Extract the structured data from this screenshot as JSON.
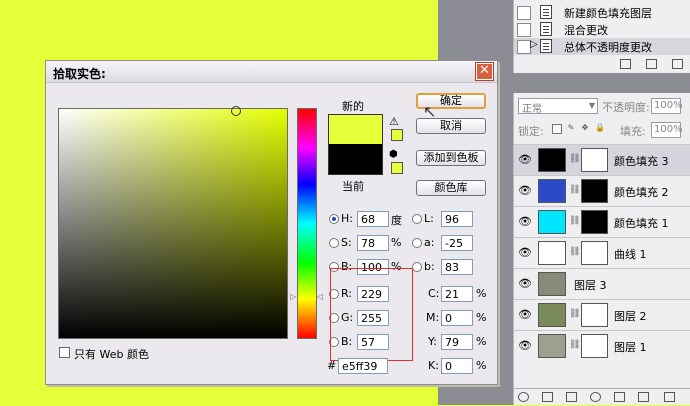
{
  "colors": {
    "foreground_new": "#e5ff39",
    "foreground_current": "#000000",
    "accent_close": "#d9603f"
  },
  "history": {
    "items": [
      {
        "label": "新建颜色填充图层",
        "selected": false
      },
      {
        "label": "混合更改",
        "selected": false
      },
      {
        "label": "总体不透明度更改",
        "selected": true
      }
    ]
  },
  "layers": {
    "blend_mode": "正常",
    "opacity_label": "不透明度:",
    "opacity_value": "100%",
    "lock_label": "锁定:",
    "fill_label": "填充:",
    "fill_value": "100%",
    "items": [
      {
        "name": "颜色填充 3",
        "thumb_color": "#000000",
        "mask": "#ffffff",
        "selected": true
      },
      {
        "name": "颜色填充 2",
        "thumb_color": "#2b49c8",
        "mask": "#000000",
        "selected": false
      },
      {
        "name": "颜色填充 1",
        "thumb_color": "#00e5ff",
        "mask": "#000000",
        "selected": false
      },
      {
        "name": "曲线 1",
        "thumb_color": "#ffffff",
        "mask": "#ffffff",
        "selected": false
      },
      {
        "name": "图层 3",
        "thumb_color": "#8a8a7a",
        "mask": "",
        "selected": false
      },
      {
        "name": "图层 2",
        "thumb_color": "#7a8a5a",
        "mask": "#ffffff",
        "selected": false
      },
      {
        "name": "图层 1",
        "thumb_color": "#a0a090",
        "mask": "#ffffff",
        "selected": false
      }
    ]
  },
  "dialog": {
    "title": "拾取实色:",
    "close_label": "✕",
    "new_label": "新的",
    "current_label": "当前",
    "buttons": {
      "ok": "确定",
      "cancel": "取消",
      "add_swatch": "添加到色板",
      "libraries": "颜色库"
    },
    "web_only_label": "只有 Web 颜色",
    "hsb": {
      "h": {
        "label": "H:",
        "value": "68",
        "unit": "度"
      },
      "s": {
        "label": "S:",
        "value": "78",
        "unit": "%"
      },
      "b": {
        "label": "B:",
        "value": "100",
        "unit": "%"
      }
    },
    "rgb": {
      "r": {
        "label": "R:",
        "value": "229"
      },
      "g": {
        "label": "G:",
        "value": "255"
      },
      "b": {
        "label": "B:",
        "value": "57"
      }
    },
    "lab": {
      "l": {
        "label": "L:",
        "value": "96"
      },
      "a": {
        "label": "a:",
        "value": "-25"
      },
      "b": {
        "label": "b:",
        "value": "83"
      }
    },
    "cmyk": {
      "c": {
        "label": "C:",
        "value": "21",
        "unit": "%"
      },
      "m": {
        "label": "M:",
        "value": "0",
        "unit": "%"
      },
      "y": {
        "label": "Y:",
        "value": "79",
        "unit": "%"
      },
      "k": {
        "label": "K:",
        "value": "0",
        "unit": "%"
      }
    },
    "hex_label": "#",
    "hex_value": "e5ff39"
  }
}
